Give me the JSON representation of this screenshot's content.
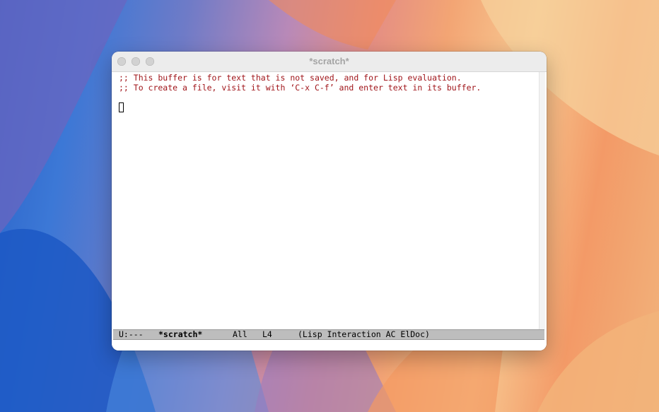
{
  "window": {
    "title": "*scratch*"
  },
  "editor": {
    "lines": [
      ";; This buffer is for text that is not saved, and for Lisp evaluation.",
      ";; To create a file, visit it with ‘C-x C-f’ and enter text in its buffer."
    ],
    "comment_color": "#a0151a"
  },
  "modeline": {
    "status": "U:---",
    "buffer_name": "*scratch*",
    "position": "All",
    "line": "L4",
    "modes": "(Lisp Interaction AC ElDoc)"
  }
}
